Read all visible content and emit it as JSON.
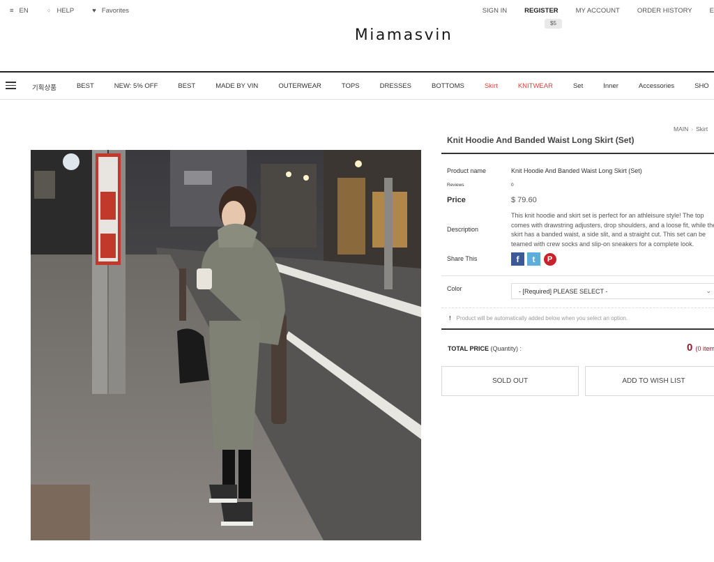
{
  "topbar": {
    "lang": "EN",
    "help": "HELP",
    "favorites": "Favorites",
    "sign_in": "SIGN IN",
    "register": "REGISTER",
    "my_account": "MY ACCOUNT",
    "order_history": "ORDER HISTORY",
    "register_badge": "$5"
  },
  "logo": "Miamasvin",
  "nav": {
    "items": [
      {
        "label": "기획상품"
      },
      {
        "label": "BEST"
      },
      {
        "label": "NEW: 5% OFF"
      },
      {
        "label": "BEST"
      },
      {
        "label": "MADE BY VIN"
      },
      {
        "label": "OUTERWEAR"
      },
      {
        "label": "TOPS"
      },
      {
        "label": "DRESSES"
      },
      {
        "label": "BOTTOMS"
      },
      {
        "label": "Skirt"
      },
      {
        "label": "KNITWEAR"
      },
      {
        "label": "Set"
      },
      {
        "label": "Inner"
      },
      {
        "label": "Accessories"
      },
      {
        "label": "SHO"
      }
    ],
    "highlight_color": "#d0463e"
  },
  "breadcrumb": {
    "home": "MAIN",
    "current": "Skirt"
  },
  "product": {
    "title": "Knit Hoodie And Banded Waist Long Skirt (Set)",
    "name_label": "Product name",
    "name_value": "Knit Hoodie And Banded Waist Long Skirt (Set)",
    "reviews_label": "Reviews",
    "reviews_value": "0",
    "price_label": "Price",
    "price_value": "$ 79.60",
    "description_label": "Description",
    "description": "This knit hoodie and skirt set is perfect for an athleisure style! The top comes with drawstring adjusters, drop shoulders, and a loose fit, while the skirt has a banded waist, a side slit, and a straight cut. This set can be teamed with crew socks and slip-on sneakers for a complete look.",
    "share_label": "Share This",
    "share_icons": [
      "facebook-icon",
      "twitter-icon",
      "pinterest-icon"
    ],
    "color_label": "Color",
    "color_placeholder": "- [Required] PLEASE SELECT -",
    "notice": "Product will be automatically added below when you select an option.",
    "notice_mark": "!",
    "total_label": "TOTAL PRICE",
    "total_qty_label": "(Quantity) :",
    "total_value": "0",
    "total_items": "(0 item",
    "sold_out": "SOLD OUT",
    "wish": "ADD TO WISH LIST",
    "total_color": "#8e1f2c"
  }
}
